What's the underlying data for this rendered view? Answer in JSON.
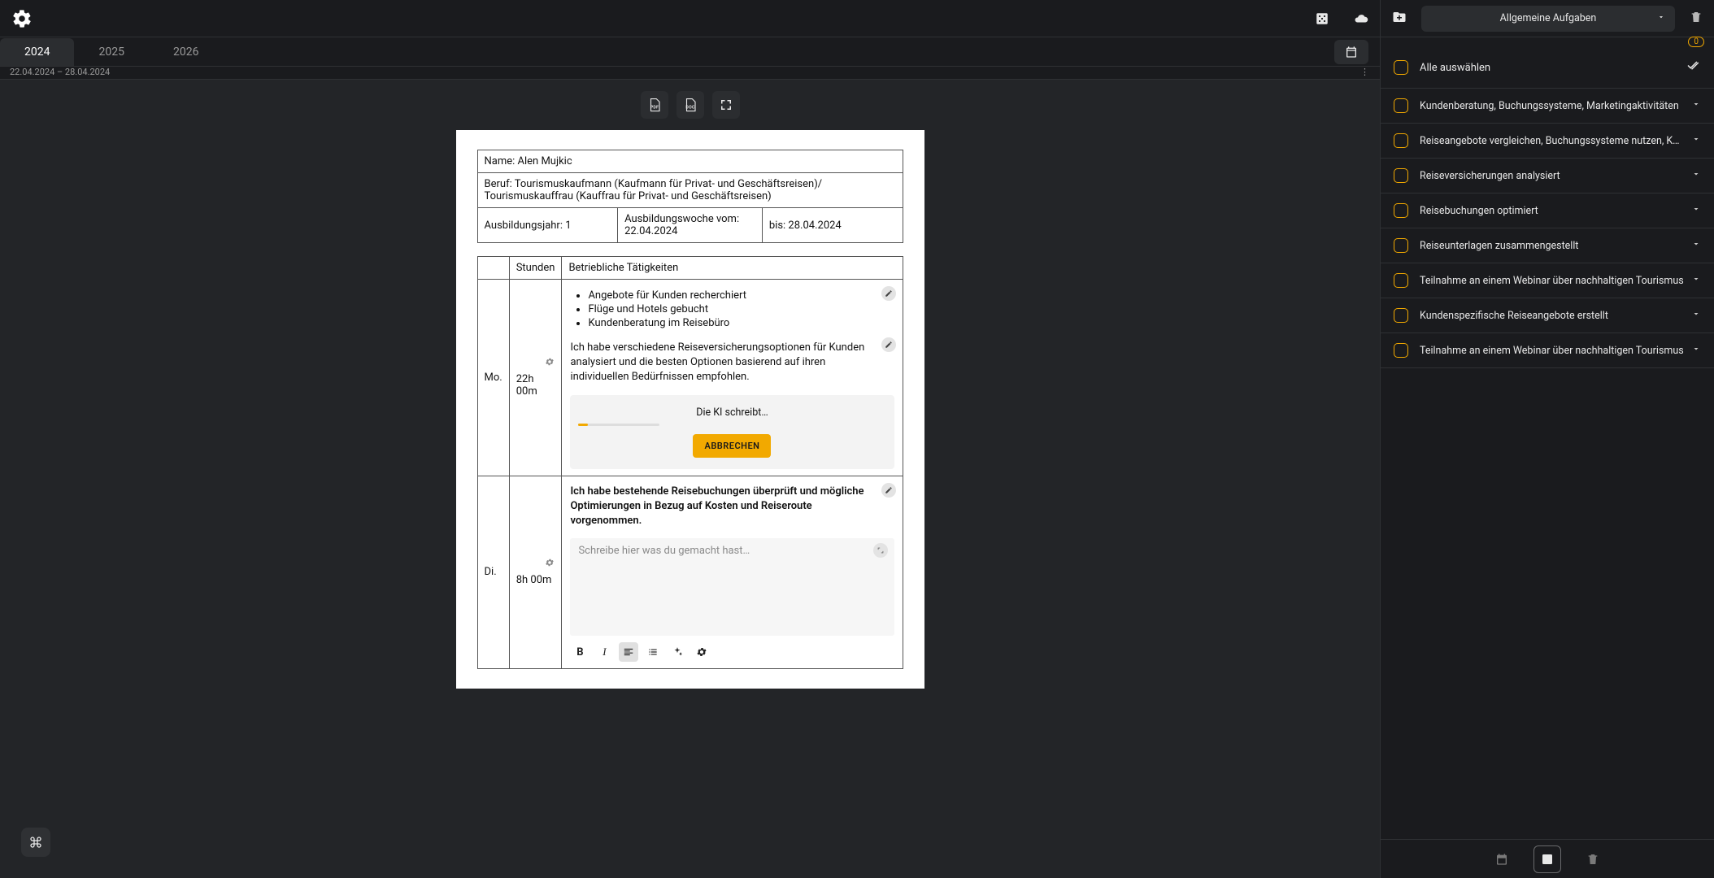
{
  "tabs": {
    "y2024": "2024",
    "y2025": "2025",
    "y2026": "2026"
  },
  "subheader": {
    "range": "22.04.2024 – 28.04.2024",
    "dots": "⋮"
  },
  "doc": {
    "name_label": "Name: Alen Mujkic",
    "beruf": "Beruf: Tourismuskaufmann (Kaufmann für Privat- und Geschäftsreisen)/ Tourismuskauffrau (Kauffrau für Privat- und Geschäftsreisen)",
    "jahr": "Ausbildungsjahr: 1",
    "woche": "Ausbildungswoche vom: 22.04.2024",
    "bis": "bis: 28.04.2024",
    "cols": {
      "blank": "",
      "stunden": "Stunden",
      "taetig": "Betriebliche Tätigkeiten"
    },
    "rows": {
      "mo": {
        "day": "Mo.",
        "hours": "22h 00m",
        "bullets": {
          "b0": "Angebote für Kunden recherchiert",
          "b1": "Flüge und Hotels gebucht",
          "b2": "Kundenberatung im Reisebüro"
        },
        "text": "Ich habe verschiedene Reiseversicherungsoptionen für Kunden analysiert und die besten Optionen basierend auf ihren individuellen Bedürfnissen empfohlen.",
        "ai_msg": "Die KI schreibt…",
        "ai_cancel": "ABBRECHEN"
      },
      "di": {
        "day": "Di.",
        "hours": "8h 00m",
        "text": "Ich habe bestehende Reisebuchungen überprüft und mögliche Optimierungen in Bezug auf Kosten und Reiseroute vorgenommen.",
        "placeholder": "Schreibe hier was du gemacht hast…"
      }
    },
    "fmt": {
      "b": "B",
      "i": "I"
    }
  },
  "side": {
    "dropdown": "Allgemeine Aufgaben",
    "badge": "0",
    "select_all": "Alle auswählen",
    "tasks": {
      "t0": "Kundenberatung, Buchungssysteme, Marketingaktivitäten",
      "t1": "Reiseangebote vergleichen, Buchungssysteme nutzen, Kunde…",
      "t2": "Reiseversicherungen analysiert",
      "t3": "Reisebuchungen optimiert",
      "t4": "Reiseunterlagen zusammengestellt",
      "t5": "Teilnahme an einem Webinar über nachhaltigen Tourismus",
      "t6": "Kundenspezifische Reiseangebote erstellt",
      "t7": "Teilnahme an einem Webinar über nachhaltigen Tourismus"
    }
  }
}
